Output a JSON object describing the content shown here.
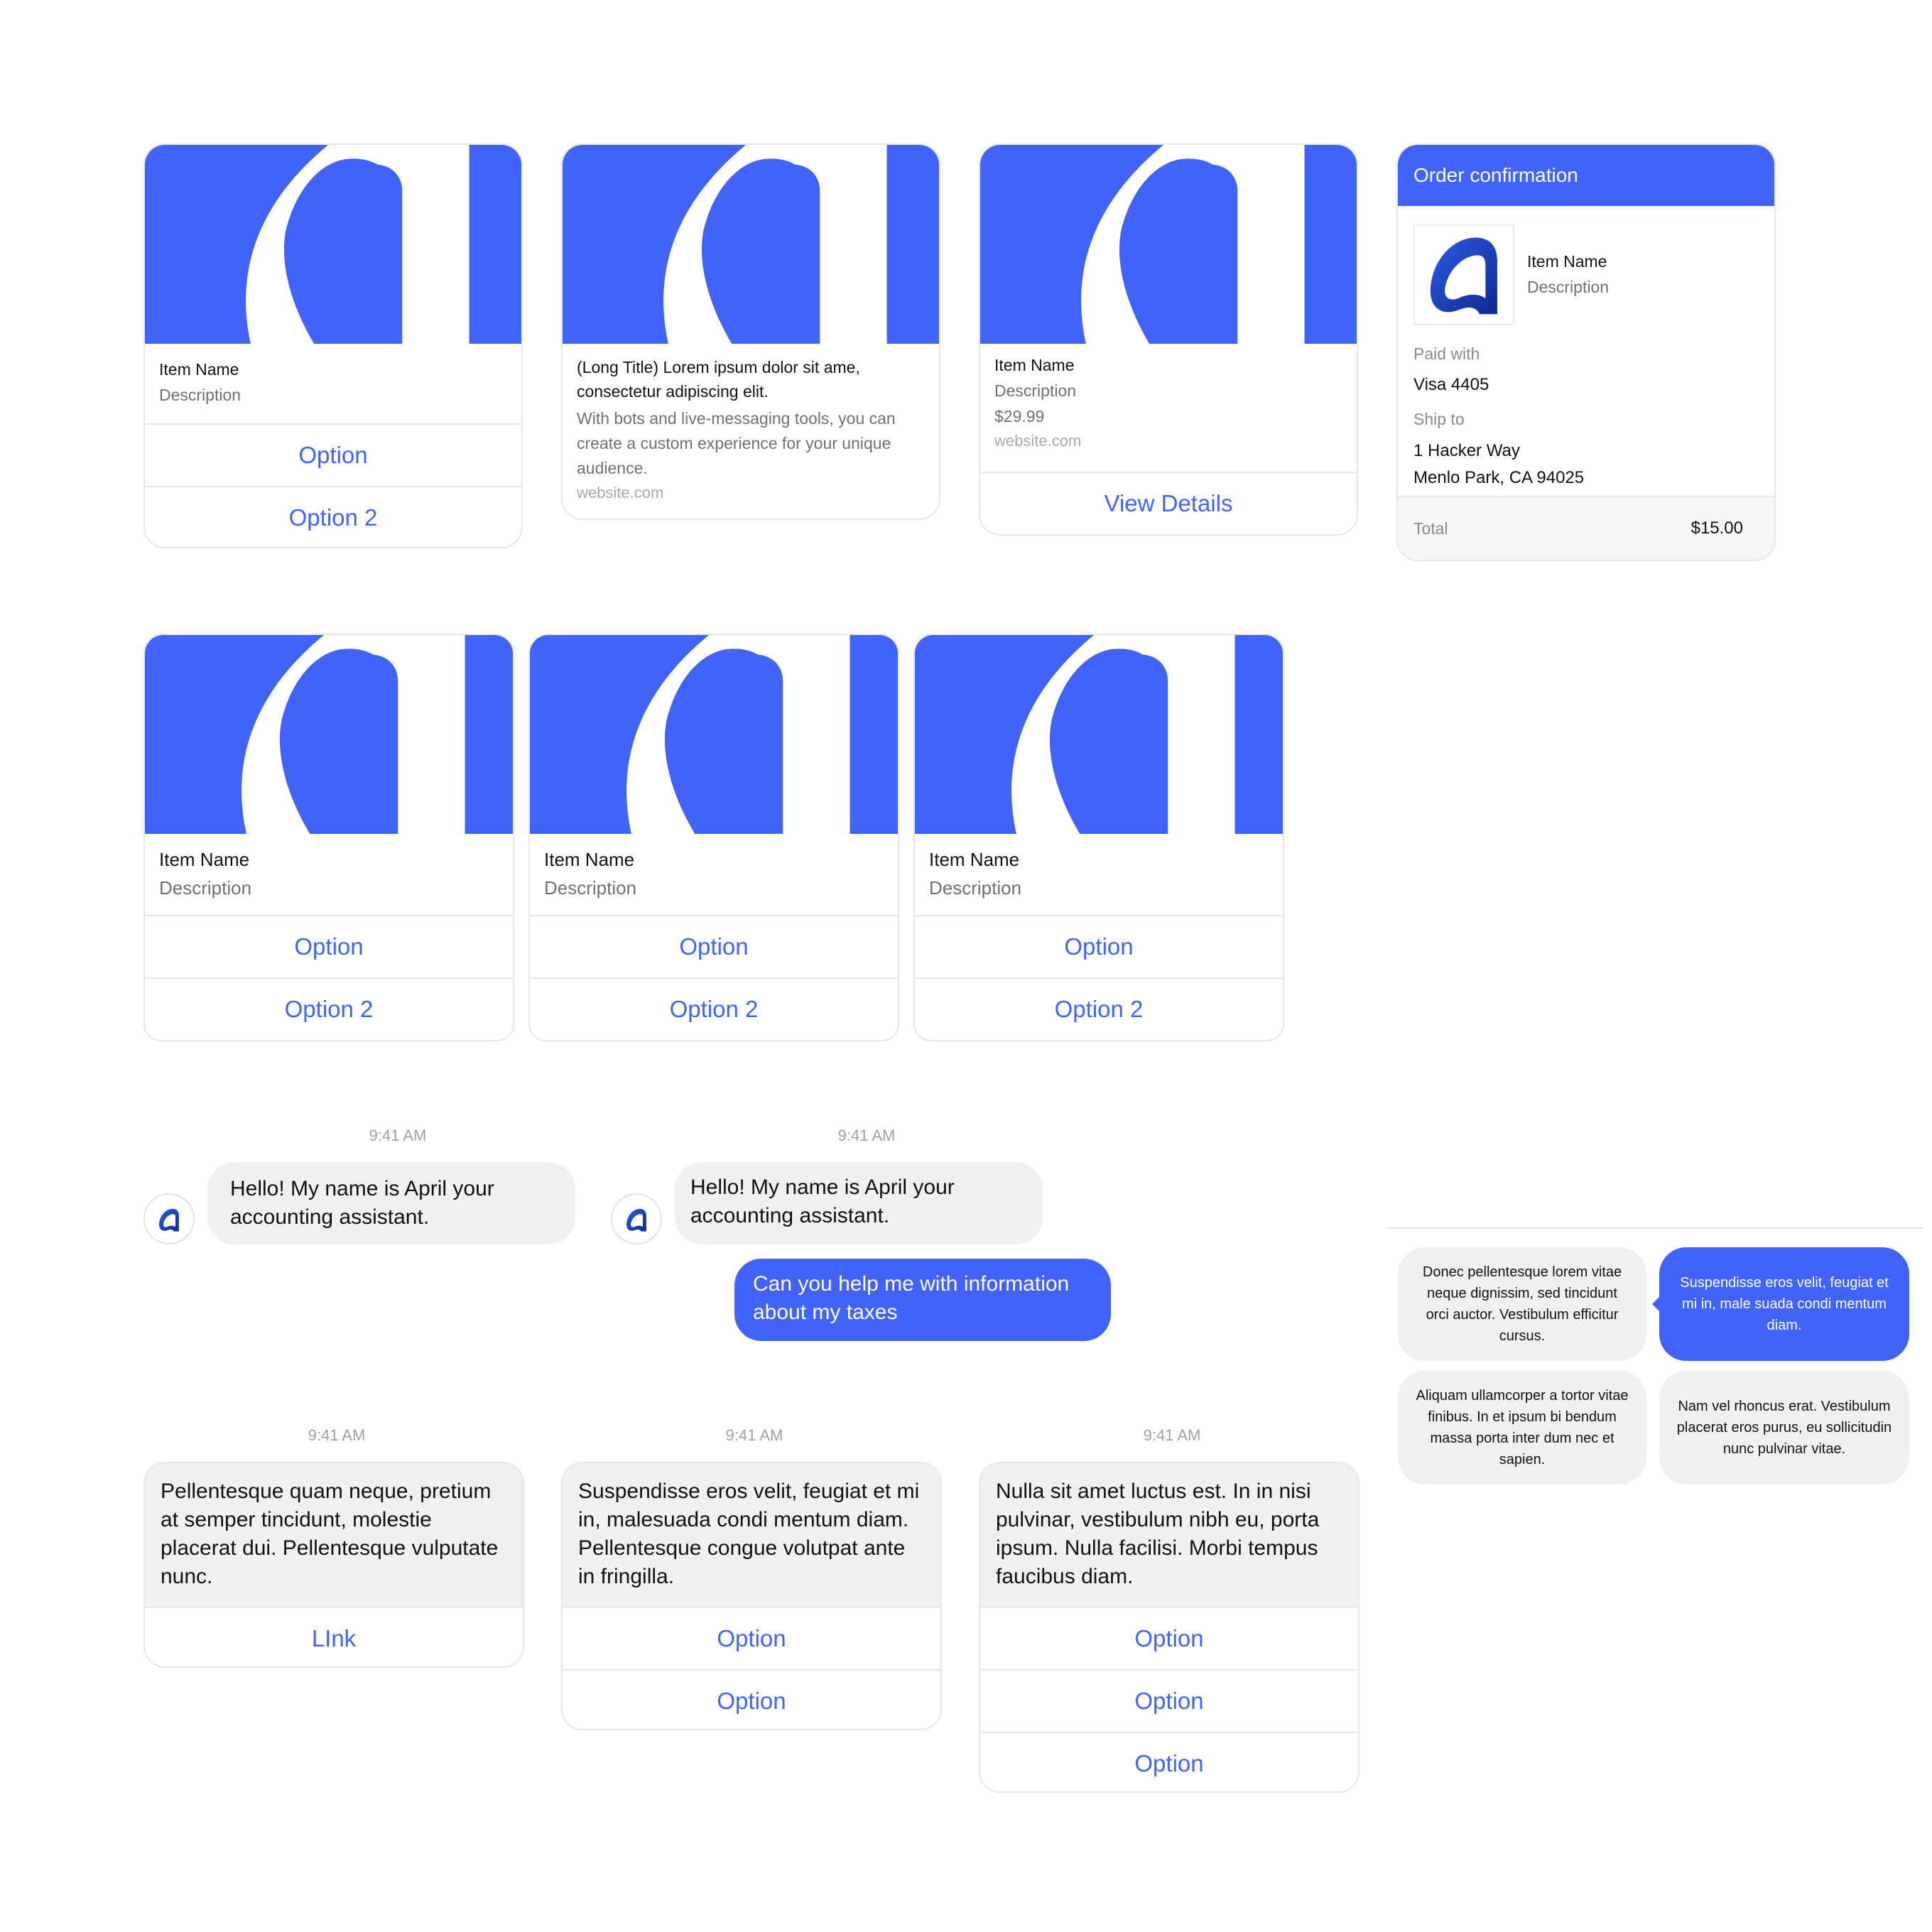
{
  "colors": {
    "accent": "#4263fa",
    "bubble_gray": "#f0f0f0",
    "border": "#e7e7e7",
    "muted": "#707070"
  },
  "row1": {
    "card1": {
      "name": "Item Name",
      "desc": "Description",
      "options": [
        "Option",
        "Option 2"
      ]
    },
    "card2": {
      "title": "(Long Title) Lorem ipsum dolor sit ame, consectetur adipiscing elit.",
      "body": "With bots and live-messaging tools, you can create a custom experience for your unique audience.",
      "site": "website.com"
    },
    "card3": {
      "name": "Item Name",
      "desc": "Description",
      "price": "$29.99",
      "site": "website.com",
      "button": "View Details"
    },
    "order": {
      "header": "Order confirmation",
      "item_name": "Item Name",
      "item_desc": "Description",
      "paid_label": "Paid with",
      "paid_value": "Visa 4405",
      "ship_label": "Ship to",
      "ship_line1": "1 Hacker Way",
      "ship_line2": "Menlo Park, CA 94025",
      "total_label": "Total",
      "total_value": "$15.00"
    }
  },
  "row2": [
    {
      "name": "Item Name",
      "desc": "Description",
      "options": [
        "Option",
        "Option 2"
      ]
    },
    {
      "name": "Item Name",
      "desc": "Description",
      "options": [
        "Option",
        "Option 2"
      ]
    },
    {
      "name": "Item Name",
      "desc": "Description",
      "options": [
        "Option",
        "Option 2"
      ]
    }
  ],
  "chat1": {
    "time": "9:41 AM",
    "message": "Hello! My name is April your accounting assistant."
  },
  "chat2": {
    "time": "9:41 AM",
    "message": "Hello! My name is April your accounting assistant.",
    "reply": "Can you help me with information about my taxes"
  },
  "msgcards": [
    {
      "time": "9:41 AM",
      "text": "Pellentesque quam neque, pretium at semper tincidunt, molestie placerat dui. Pellentesque vulputate nunc.",
      "buttons": [
        "LInk"
      ]
    },
    {
      "time": "9:41 AM",
      "text": "Suspendisse eros velit, feugiat et mi in, malesuada condi mentum diam. Pellentesque congue volutpat ante in fringilla.",
      "buttons": [
        "Option",
        "Option"
      ]
    },
    {
      "time": "9:41 AM",
      "text": "Nulla sit amet luctus est. In in nisi pulvinar, vestibulum nibh eu, porta ipsum. Nulla facilisi. Morbi tempus faucibus diam.",
      "buttons": [
        "Option",
        "Option",
        "Option"
      ]
    }
  ],
  "grid_bubbles": [
    {
      "text": "Donec pellentesque lorem vitae neque dignissim, sed tincidunt orci auctor. Vestibulum efficitur cursus.",
      "style": "gray"
    },
    {
      "text": "Suspendisse eros velit, feugiat et mi in, male suada condi mentum diam.",
      "style": "blue"
    },
    {
      "text": "Aliquam ullamcorper a tortor vitae finibus. In et ipsum bi bendum massa porta inter dum nec et sapien.",
      "style": "gray"
    },
    {
      "text": "Nam vel rhoncus erat. Vestibulum placerat eros purus, eu sollicitudin nunc pulvinar vitae.",
      "style": "gray"
    }
  ]
}
